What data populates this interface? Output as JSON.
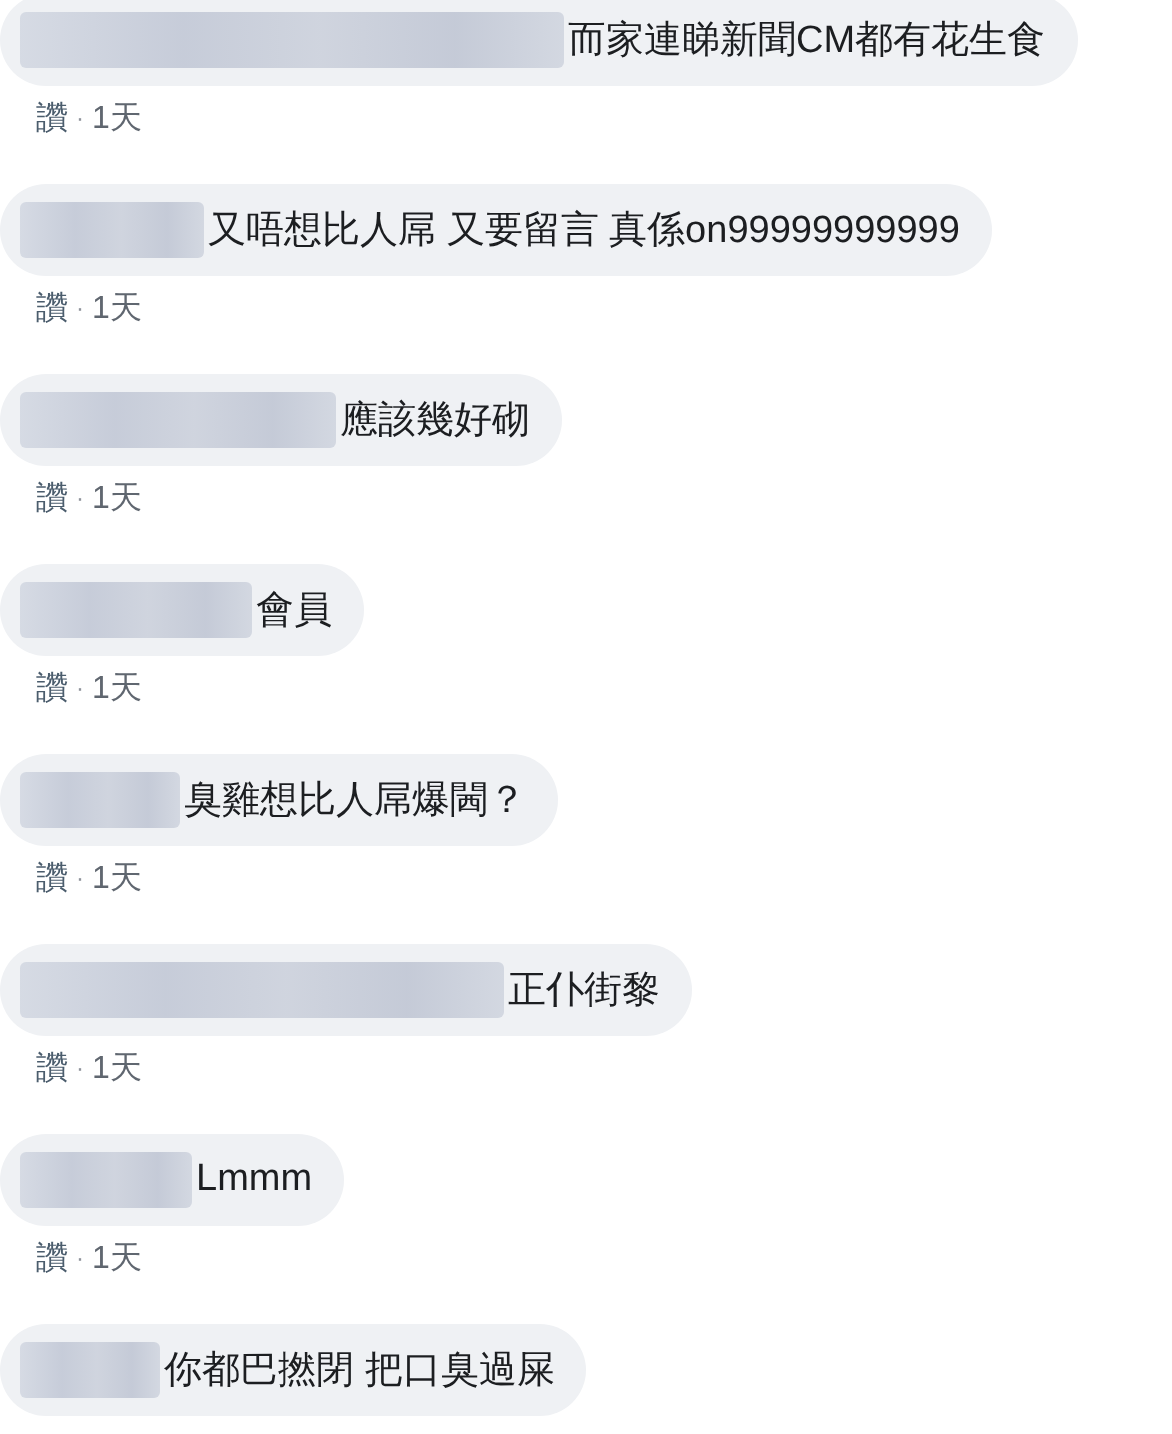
{
  "comments": [
    {
      "text": "而家連睇新聞CM都有花生食",
      "like": "讚",
      "separator": "·",
      "time": "1天"
    },
    {
      "text": "又唔想比人屌 又要留言 真係on99999999999",
      "like": "讚",
      "separator": "·",
      "time": "1天"
    },
    {
      "text": "應該幾好砌",
      "like": "讚",
      "separator": "·",
      "time": "1天"
    },
    {
      "text": "會員",
      "like": "讚",
      "separator": "·",
      "time": "1天"
    },
    {
      "text": "臭雞想比人屌爆閪？",
      "like": "讚",
      "separator": "·",
      "time": "1天"
    },
    {
      "text": "正仆街黎",
      "like": "讚",
      "separator": "·",
      "time": "1天"
    },
    {
      "text": "Lmmm",
      "like": "讚",
      "separator": "·",
      "time": "1天"
    },
    {
      "text": "你都巴撚閉 把口臭過屎"
    }
  ]
}
